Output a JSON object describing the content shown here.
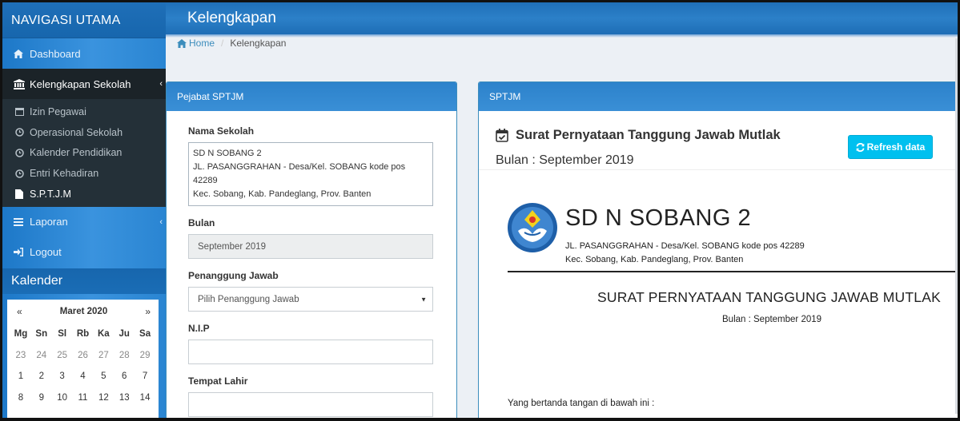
{
  "sidebar": {
    "title": "NAVIGASI UTAMA",
    "items": [
      {
        "label": "Dashboard",
        "icon": "dashboard-icon"
      },
      {
        "label": "Kelengkapan Sekolah",
        "icon": "bank-icon",
        "active": true
      },
      {
        "label": "Laporan",
        "icon": "list-icon"
      },
      {
        "label": "Logout",
        "icon": "logout-icon"
      }
    ],
    "submenu": [
      {
        "label": "Izin Pegawai",
        "icon": "calendar-icon"
      },
      {
        "label": "Operasional Sekolah",
        "icon": "clock-icon"
      },
      {
        "label": "Kalender Pendidikan",
        "icon": "clock-icon"
      },
      {
        "label": "Entri Kehadiran",
        "icon": "clock-icon"
      },
      {
        "label": "S.P.T.J.M",
        "icon": "document-icon",
        "current": true
      }
    ],
    "calendar_title": "Kalender"
  },
  "calendar": {
    "prev": "«",
    "next": "»",
    "month": "Maret 2020",
    "days": [
      "Mg",
      "Sn",
      "Sl",
      "Rb",
      "Ka",
      "Ju",
      "Sa"
    ],
    "weeks": [
      [
        "23",
        "24",
        "25",
        "26",
        "27",
        "28",
        "29"
      ],
      [
        "1",
        "2",
        "3",
        "4",
        "5",
        "6",
        "7"
      ],
      [
        "8",
        "9",
        "10",
        "11",
        "12",
        "13",
        "14"
      ]
    ]
  },
  "header": {
    "title": "Kelengkapan"
  },
  "breadcrumb": {
    "home": "Home",
    "current": "Kelengkapan"
  },
  "left_panel": {
    "title": "Pejabat SPTJM",
    "fields": {
      "nama_sekolah_label": "Nama Sekolah",
      "nama_sekolah_value": "SD N SOBANG 2\nJL. PASANGGRAHAN - Desa/Kel. SOBANG kode pos 42289\nKec. Sobang, Kab. Pandeglang, Prov. Banten",
      "bulan_label": "Bulan",
      "bulan_value": "September 2019",
      "penanggung_label": "Penanggung Jawab",
      "penanggung_value": "Pilih Penanggung Jawab",
      "nip_label": "N.I.P",
      "nip_value": "",
      "tempat_label": "Tempat Lahir",
      "tempat_value": ""
    }
  },
  "right_panel": {
    "title": "SPTJM",
    "heading": "Surat Pernyataan Tanggung Jawab Mutlak",
    "subheading": "Bulan : September 2019",
    "refresh_label": "Refresh data",
    "document": {
      "school_name": "SD N SOBANG 2",
      "address_line1": "JL. PASANGGRAHAN - Desa/Kel. SOBANG kode pos 42289",
      "address_line2": "Kec. Sobang, Kab. Pandeglang, Prov. Banten",
      "title": "SURAT PERNYATAAN TANGGUNG JAWAB MUTLAK",
      "bulan": "Bulan : September 2019",
      "opening": "Yang bertanda tangan di bawah ini :"
    }
  },
  "colors": {
    "sidebar": "#2a85d2",
    "active_item": "#1b2328",
    "accent": "#3c8dbc",
    "refresh_button": "#00c0ef"
  }
}
